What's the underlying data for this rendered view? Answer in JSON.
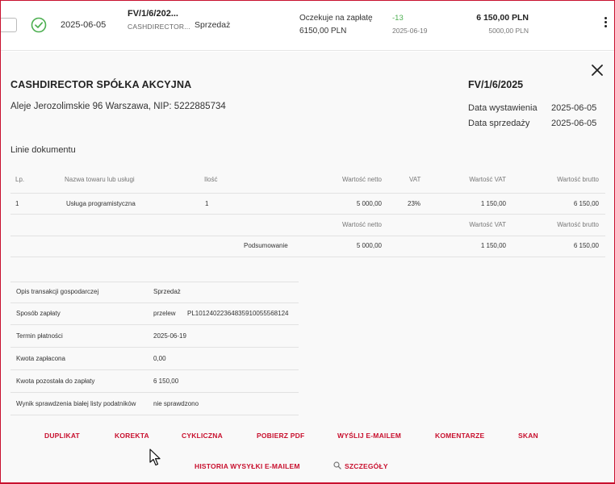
{
  "row": {
    "issue_date": "2025-06-05",
    "invoice_number": "FV/1/6/202...",
    "contractor": "CASHDIRECTOR...",
    "type": "Sprzedaż",
    "payment_status": "Oczekuje na zapłatę",
    "payment_amount": "6150,00 PLN",
    "days": "-13",
    "due_date": "2025-06-19",
    "gross": "6 150,00 PLN",
    "net": "5000,00 PLN",
    "status_icon": "check-circle-icon",
    "menu_icon": "kebab-menu-icon",
    "colors": {
      "status_ok": "#4caf50",
      "days": "#4caf50"
    }
  },
  "details": {
    "seller_name": "CASHDIRECTOR SPÓŁKA AKCYJNA",
    "seller_address": "Aleje Jerozolimskie 96 Warszawa, NIP: 5222885734",
    "document_number": "FV/1/6/2025",
    "issue_label": "Data wystawienia",
    "issue_value": "2025-06-05",
    "sale_label": "Data sprzedaży",
    "sale_value": "2025-06-05",
    "close_icon": "close-icon",
    "lines_title": "Linie dokumentu",
    "lines_table": {
      "headers": {
        "lp": "Lp.",
        "name": "Nazwa towaru lub usługi",
        "qty": "Ilość",
        "net": "Wartość netto",
        "vat": "VAT",
        "vat_value": "Wartość VAT",
        "gross": "Wartość brutto"
      },
      "rows": [
        {
          "lp": "1",
          "name": "Usługa programistyczna",
          "qty": "1",
          "net": "5 000,00",
          "vat": "23%",
          "vat_value": "1 150,00",
          "gross": "6 150,00"
        }
      ],
      "summary_headers": {
        "net": "Wartość netto",
        "vat_value": "Wartość VAT",
        "gross": "Wartość brutto"
      },
      "summary": {
        "label": "Podsumowanie",
        "net": "5 000,00",
        "vat_value": "1 150,00",
        "gross": "6 150,00"
      }
    },
    "info": [
      {
        "label": "Opis transakcji gospodarczej",
        "value": "Sprzedaż"
      },
      {
        "label": "Sposób zapłaty",
        "value": "przelew",
        "extra": "PL10124022364835910055568124"
      },
      {
        "label": "Termin płatności",
        "value": "2025-06-19"
      },
      {
        "label": "Kwota zapłacona",
        "value": "0,00"
      },
      {
        "label": "Kwota pozostała do zapłaty",
        "value": "6 150,00"
      },
      {
        "label": "Wynik sprawdzenia białej listy podatników",
        "value": "nie sprawdzono"
      }
    ]
  },
  "actions": {
    "duplicate": "DUPLIKAT",
    "correction": "KOREKTA",
    "recurring": "CYKLICZNA",
    "download_pdf": "POBIERZ PDF",
    "send_email": "WYŚLIJ E-MAILEM",
    "comments": "KOMENTARZE",
    "scan": "SKAN",
    "email_history": "HISTORIA WYSYŁKI E-MAILEM",
    "details": "SZCZEGÓŁY",
    "details_icon": "search-icon",
    "color": "#c8102e"
  }
}
